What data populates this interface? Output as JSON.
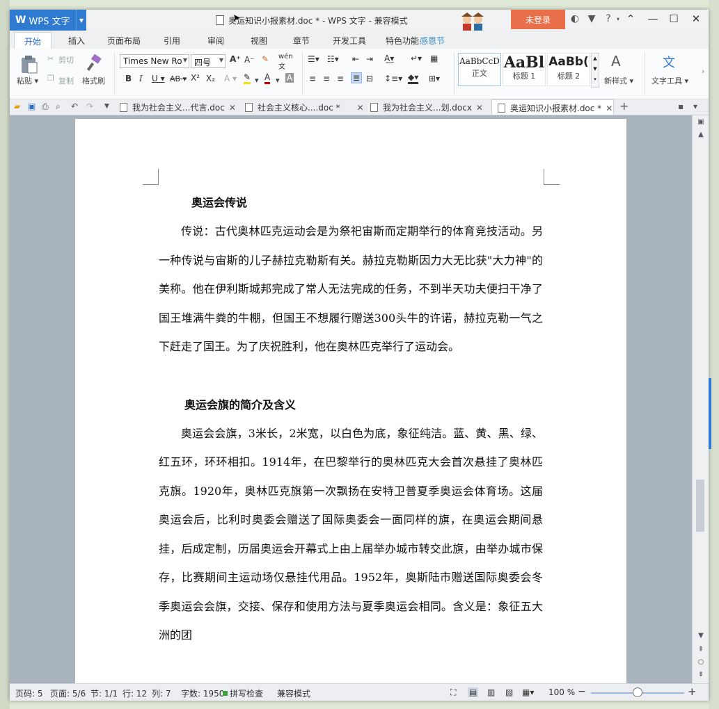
{
  "app": {
    "name": "WPS 文字",
    "window_title": "奥运知识小报素材.doc * - WPS 文字 - 兼容模式",
    "login_label": "未登录"
  },
  "ribbon_tabs": [
    "开始",
    "插入",
    "页面布局",
    "引用",
    "审阅",
    "视图",
    "章节",
    "开发工具",
    "特色功能"
  ],
  "festival_text": "感恩节",
  "clipboard": {
    "paste": "粘贴",
    "cut": "剪切",
    "copy": "复制",
    "format_painter": "格式刷"
  },
  "font": {
    "name": "Times New Ro",
    "size": "四号"
  },
  "styles": [
    {
      "sample": "AaBbCcD",
      "name": "正文"
    },
    {
      "sample": "AaBl",
      "name": "标题 1"
    },
    {
      "sample": "AaBb(",
      "name": "标题 2"
    }
  ],
  "new_style": "新样式",
  "text_tools": "文字工具",
  "doc_tabs": [
    {
      "label": "我为社会主义...代言.doc",
      "active": false
    },
    {
      "label": "社会主义核心....doc *",
      "active": false
    },
    {
      "label": "我为社会主义...划.docx",
      "active": false
    },
    {
      "label": "奥运知识小报素材.doc *",
      "active": true
    }
  ],
  "document": {
    "heading1": "奥运会传说",
    "para1": "传说：古代奥林匹克运动会是为祭祀宙斯而定期举行的体育竞技活动。另一种传说与宙斯的儿子赫拉克勒斯有关。赫拉克勒斯因力大无比获\"大力神\"的美称。他在伊利斯城邦完成了常人无法完成的任务，不到半天功夫便扫干净了国王堆满牛粪的牛棚，但国王不想履行赠送300头牛的许诺，赫拉克勒一气之下赶走了国王。为了庆祝胜利，他在奥林匹克举行了运动会。",
    "heading2": "奥运会旗的简介及含义",
    "para2": "奥运会会旗，3米长，2米宽，以白色为底，象征纯洁。蓝、黄、黑、绿、红五环，环环相扣。1914年，在巴黎举行的奥林匹克大会首次悬挂了奥林匹克旗。1920年，奥林匹克旗第一次飘扬在安特卫普夏季奥运会体育场。这届奥运会后，比利时奥委会赠送了国际奥委会一面同样的旗，在奥运会期间悬挂，后成定制，历届奥运会开幕式上由上届举办城市转交此旗，由举办城市保存，比赛期间主运动场仅悬挂代用品。1952年，奥斯陆市赠送国际奥委会冬季奥运会会旗，交接、保存和使用方法与夏季奥运会相同。含义是：象征五大洲的团"
  },
  "status": {
    "page_code": "页码: 5",
    "page": "页面: 5/6",
    "section": "节: 1/1",
    "line": "行: 12",
    "column": "列: 7",
    "word_count": "字数: 1950",
    "spell_check": "拼写检查",
    "compat": "兼容模式",
    "zoom": "100 %"
  },
  "colors": {
    "accent": "#2f7bd2",
    "login_bg": "#e96f4a",
    "tab_active": "#2f6fc1"
  }
}
